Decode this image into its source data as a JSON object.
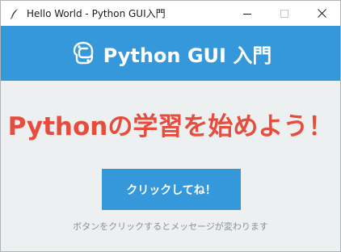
{
  "window": {
    "title": "Hello World - Python GUI入門",
    "controls": {
      "minimize_icon": "minimize-icon",
      "maximize_icon": "maximize-icon",
      "close_icon": "close-icon"
    }
  },
  "header": {
    "title": "Python GUI 入門",
    "logo_icon": "python-logo-icon",
    "background": "#3498db"
  },
  "main": {
    "headline": "Pythonの学習を始めよう！",
    "headline_color": "#e74c3c",
    "button_label": "クリックしてね！",
    "button_color": "#3498db",
    "hint": "ボタンをクリックするとメッセージが変わります",
    "background": "#ecf0f1"
  }
}
